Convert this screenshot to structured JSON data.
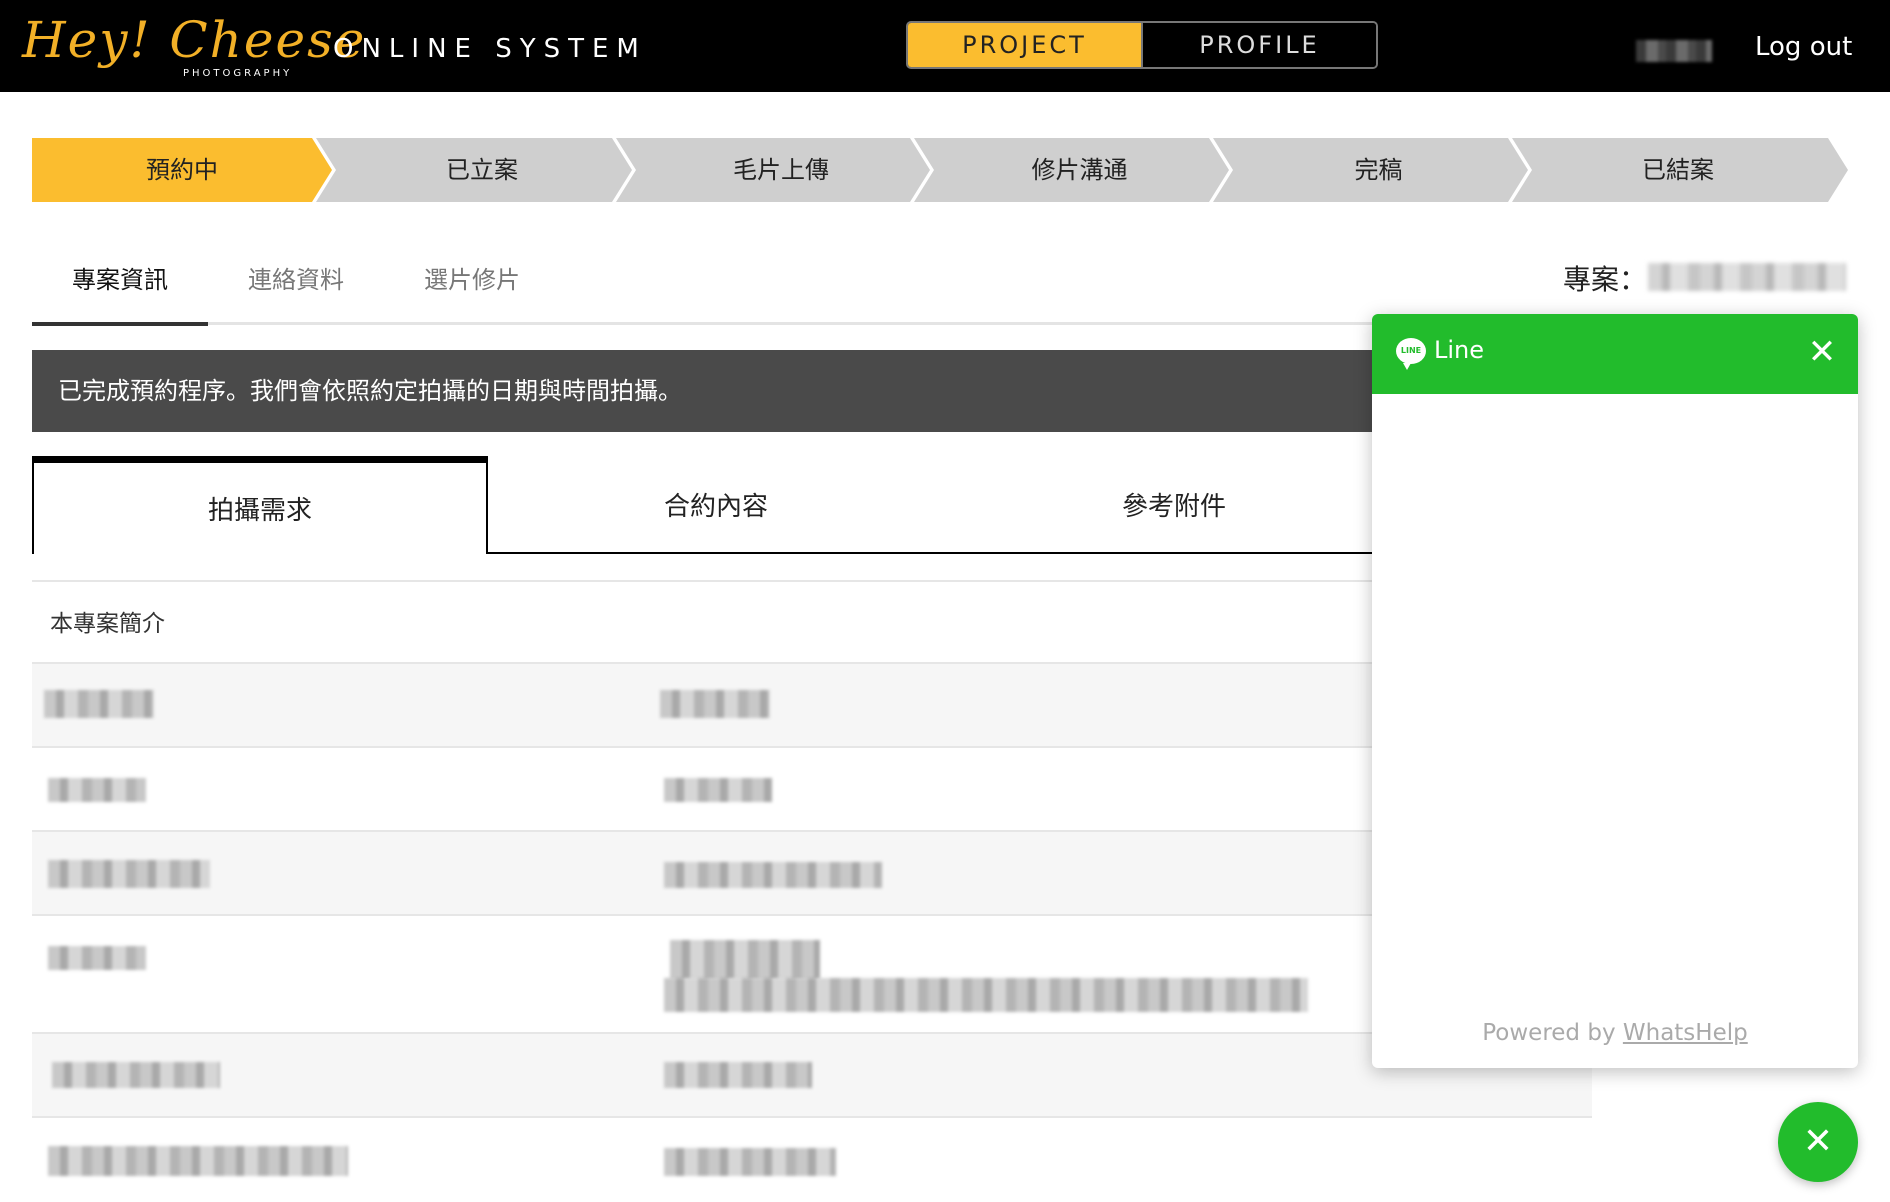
{
  "header": {
    "logo_text": "Hey! Cheese",
    "logo_sub": "PHOTOGRAPHY",
    "system_title": "ONLINE SYSTEM",
    "nav": [
      {
        "label": "PROJECT",
        "active": true
      },
      {
        "label": "PROFILE",
        "active": false
      }
    ],
    "logout_label": "Log out",
    "accent_color": "#fbbd2f"
  },
  "progress": {
    "steps": [
      {
        "label": "預約中",
        "active": true
      },
      {
        "label": "已立案",
        "active": false
      },
      {
        "label": "毛片上傳",
        "active": false
      },
      {
        "label": "修片溝通",
        "active": false
      },
      {
        "label": "完稿",
        "active": false
      },
      {
        "label": "已結案",
        "active": false
      }
    ],
    "active_color": "#fbbd2f",
    "idle_color": "#cfcfcf"
  },
  "section_tabs": [
    {
      "label": "專案資訊",
      "active": true
    },
    {
      "label": "連絡資料",
      "active": false
    },
    {
      "label": "選片修片",
      "active": false
    }
  ],
  "project_label": "專案：",
  "notice": "已完成預約程序。我們會依照約定拍攝的日期與時間拍攝。",
  "content_tabs": [
    {
      "label": "拍攝需求",
      "active": true
    },
    {
      "label": "合約內容",
      "active": false
    },
    {
      "label": "參考附件",
      "active": false
    }
  ],
  "table": {
    "heading": "本專案簡介"
  },
  "chat_popup": {
    "badge": "LINE",
    "title": "Line",
    "close_icon": "close-icon",
    "powered_prefix": "Powered by ",
    "powered_link": "WhatsHelp",
    "header_color": "#22bc2c"
  }
}
